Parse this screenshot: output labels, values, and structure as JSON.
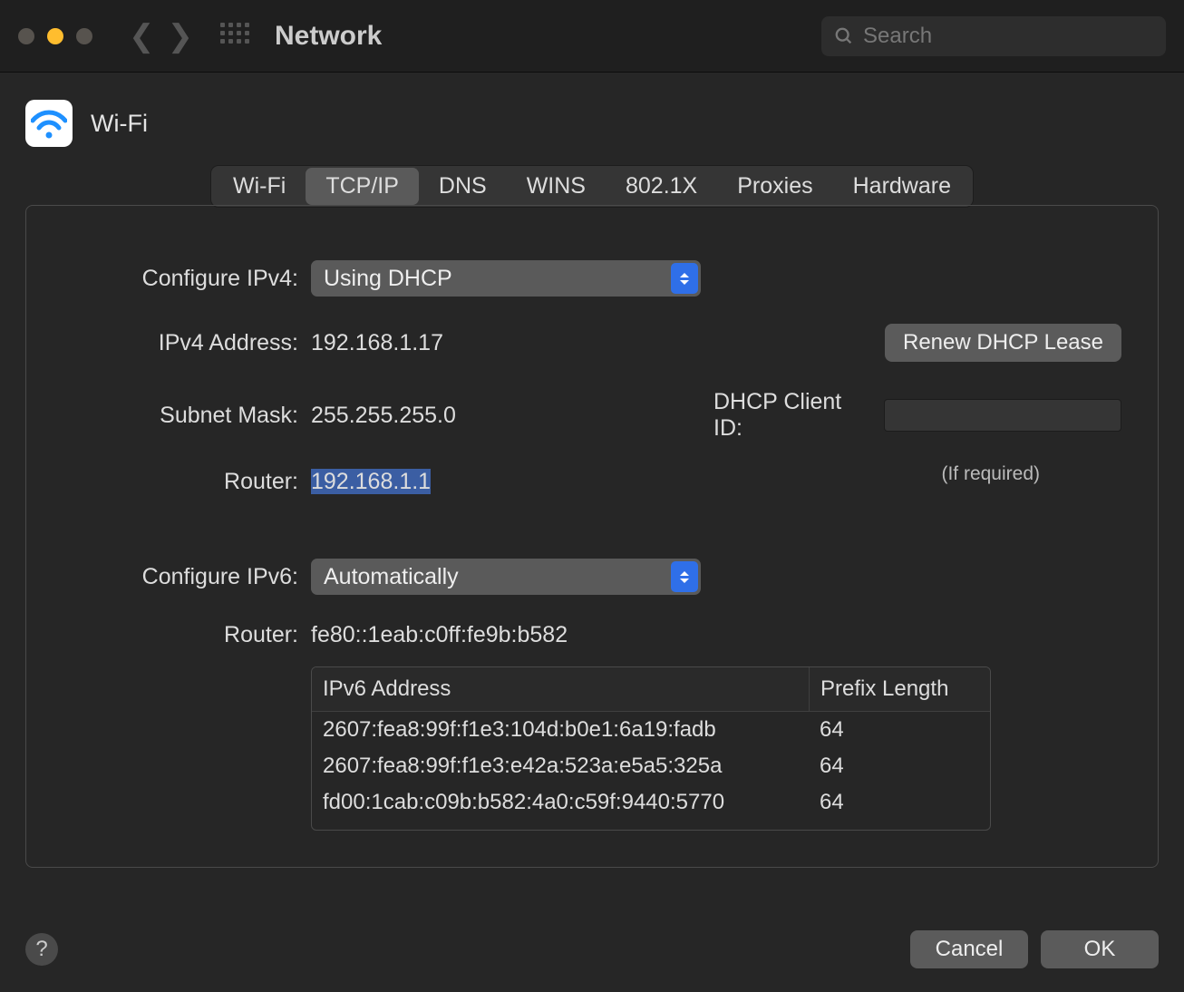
{
  "window": {
    "title": "Network"
  },
  "search": {
    "placeholder": "Search"
  },
  "page": {
    "subtitle": "Wi-Fi"
  },
  "tabs": {
    "items": [
      "Wi-Fi",
      "TCP/IP",
      "DNS",
      "WINS",
      "802.1X",
      "Proxies",
      "Hardware"
    ],
    "active": "TCP/IP"
  },
  "ipv4": {
    "configure_label": "Configure IPv4:",
    "configure_value": "Using DHCP",
    "address_label": "IPv4 Address:",
    "address_value": "192.168.1.17",
    "subnet_label": "Subnet Mask:",
    "subnet_value": "255.255.255.0",
    "router_label": "Router:",
    "router_value": "192.168.1.1",
    "renew_label": "Renew DHCP Lease",
    "client_id_label": "DHCP Client ID:",
    "client_id_value": "",
    "client_id_hint": "(If required)"
  },
  "ipv6": {
    "configure_label": "Configure IPv6:",
    "configure_value": "Automatically",
    "router_label": "Router:",
    "router_value": "fe80::1eab:c0ff:fe9b:b582",
    "table": {
      "col_addr": "IPv6 Address",
      "col_prefix": "Prefix Length",
      "rows": [
        {
          "addr": "2607:fea8:99f:f1e3:104d:b0e1:6a19:fadb",
          "prefix": "64"
        },
        {
          "addr": "2607:fea8:99f:f1e3:e42a:523a:e5a5:325a",
          "prefix": "64"
        },
        {
          "addr": "fd00:1cab:c09b:b582:4a0:c59f:9440:5770",
          "prefix": "64"
        }
      ]
    }
  },
  "footer": {
    "cancel": "Cancel",
    "ok": "OK"
  }
}
